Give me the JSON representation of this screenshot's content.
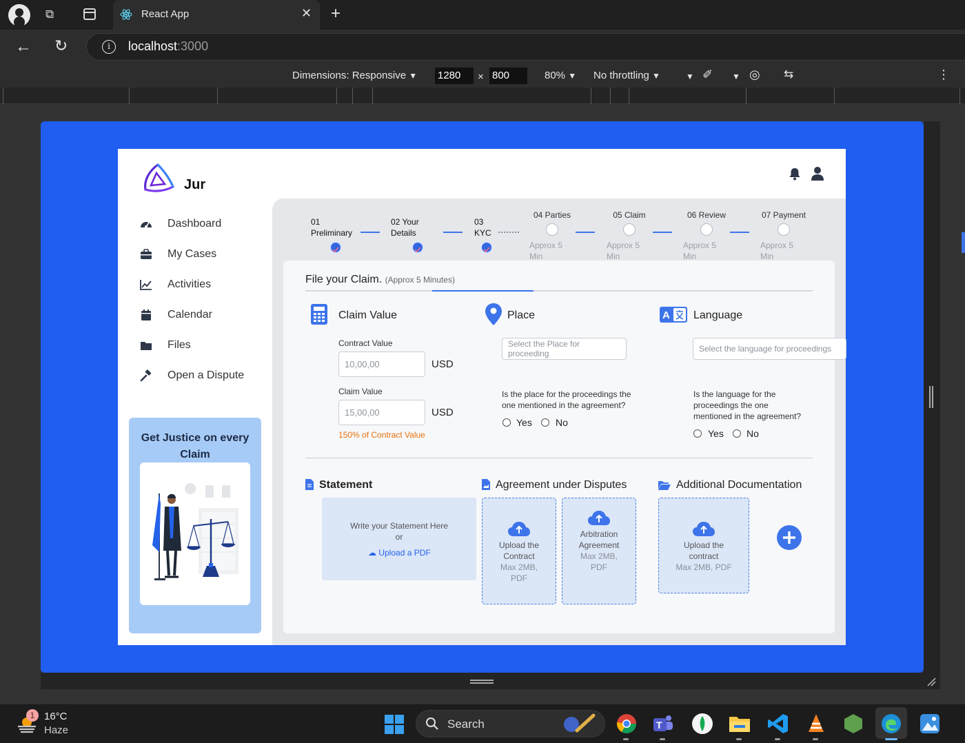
{
  "browser": {
    "tab_title": "React App",
    "url_host": "localhost",
    "url_port": ":3000"
  },
  "devtools": {
    "dimensions_label": "Dimensions: Responsive",
    "width_value": "1280",
    "times": "×",
    "height_value": "800",
    "zoom": "80%",
    "throttling": "No throttling"
  },
  "app": {
    "brand": "Jur",
    "nav": [
      {
        "label": "Dashboard",
        "icon": "gauge-icon"
      },
      {
        "label": "My Cases",
        "icon": "briefcase-icon"
      },
      {
        "label": "Activities",
        "icon": "line-chart-icon"
      },
      {
        "label": "Calendar",
        "icon": "calendar-icon"
      },
      {
        "label": "Files",
        "icon": "folder-icon"
      },
      {
        "label": "Open a Dispute",
        "icon": "gavel-icon"
      }
    ],
    "promo_text": "Get Justice on every Claim",
    "steps": [
      {
        "num": "01",
        "label": "Preliminary",
        "done": true
      },
      {
        "num": "02 Your",
        "label": "Details",
        "done": true
      },
      {
        "num": "03",
        "label": "KYC",
        "done": true
      },
      {
        "label": "04 Parties",
        "approx": "Approx 5 Min",
        "done": false
      },
      {
        "label": "05 Claim",
        "approx": "Approx 5 Min",
        "done": false
      },
      {
        "label": "06 Review",
        "approx": "Approx 5 Min",
        "done": false
      },
      {
        "label": "07 Payment",
        "approx": "Approx 5 Min",
        "done": false
      }
    ],
    "form": {
      "title": "File your Claim.",
      "title_note": "(Approx 5 Minutes)",
      "claim_value": {
        "heading": "Claim Value",
        "contract_label": "Contract Value",
        "contract_placeholder": "10,00,00",
        "claim_label": "Claim Value",
        "claim_placeholder": "15,00,00",
        "currency": "USD",
        "ratio_note": "150% of Contract Value"
      },
      "place": {
        "heading": "Place",
        "placeholder": "Select the Place for proceeding",
        "question": "Is the place for the proceedings the one mentioned in the agreement?",
        "yes": "Yes",
        "no": "No"
      },
      "language": {
        "heading": "Language",
        "placeholder": "Select the language for proceedings",
        "question": "Is the language for the proceedings the one mentioned in the agreement?",
        "yes": "Yes",
        "no": "No"
      },
      "statement": {
        "heading": "Statement",
        "line1": "Write your Statement Here",
        "line2": "or",
        "upload": "Upload a PDF"
      },
      "agreement": {
        "heading": "Agreement under Disputes",
        "contract_title": "Upload the Contract",
        "contract_note": "Max 2MB, PDF",
        "arb_title": "Arbitration Agreement",
        "arb_note": "Max 2MB, PDF"
      },
      "additional": {
        "heading": "Additional Documentation",
        "title": "Upload the contract",
        "note": "Max 2MB, PDF"
      }
    }
  },
  "taskbar": {
    "weather_temp": "16°C",
    "weather_desc": "Haze",
    "badge": "1",
    "search": "Search"
  },
  "colors": {
    "stage": "#1f5ef0",
    "accent": "#3d74ea",
    "warning": "#e8710a"
  }
}
